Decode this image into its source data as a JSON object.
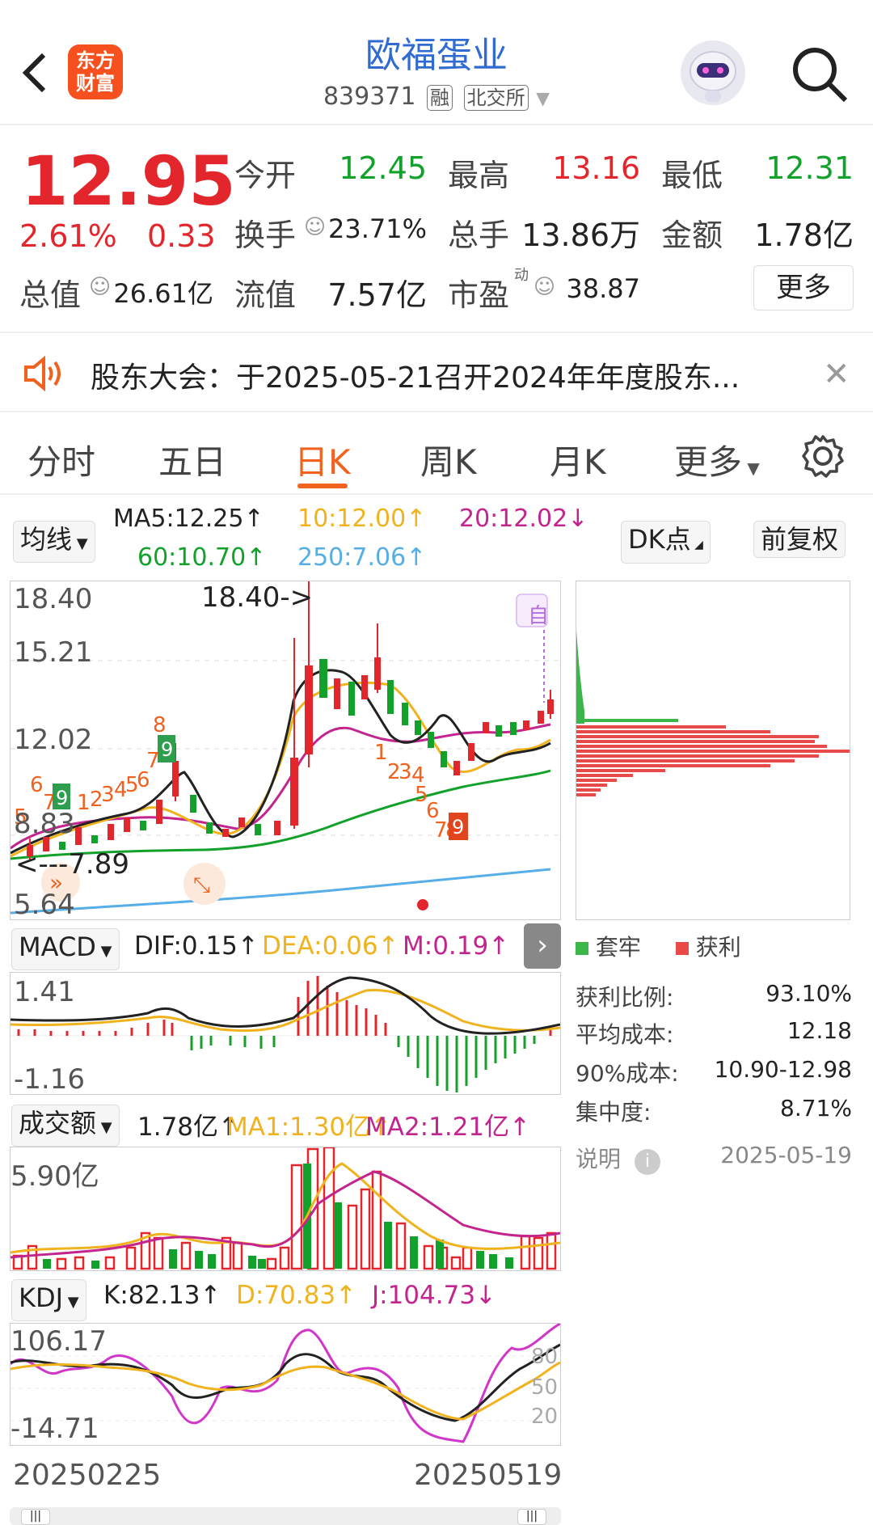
{
  "header": {
    "title": "欧福蛋业",
    "code": "839371",
    "tag1": "融",
    "tag2": "北交所",
    "logo_line1": "东方",
    "logo_line2": "财富"
  },
  "quote": {
    "price": "12.95",
    "change_pct": "2.61%",
    "change_amt": "0.33",
    "open_label": "今开",
    "open": "12.45",
    "high_label": "最高",
    "high": "13.16",
    "low_label": "最低",
    "low": "12.31",
    "turnover_label": "换手",
    "turnover": "23.71%",
    "volume_label": "总手",
    "volume": "13.86万",
    "amount_label": "金额",
    "amount": "1.78亿",
    "mktcap_label": "总值",
    "mktcap": "26.61亿",
    "float_label": "流值",
    "float": "7.57亿",
    "pe_label": "市盈",
    "pe_sup": "动",
    "pe": "38.87",
    "more": "更多"
  },
  "notice": {
    "text": "股东大会：于2025-05-21召开2024年年度股东..."
  },
  "tabs": [
    "分时",
    "五日",
    "日K",
    "周K",
    "月K",
    "更多"
  ],
  "chart_controls": {
    "ma_chip": "均线",
    "ma5": "MA5:12.25↑",
    "ma10": "10:12.00↑",
    "ma20": "20:12.02↓",
    "ma60": "60:10.70↑",
    "ma250": "250:7.06↑",
    "dk_chip": "DK点",
    "adj_chip": "前复权"
  },
  "main_chart": {
    "y_top": "18.40",
    "y_mid1": "15.21",
    "y_mid2": "12.02",
    "y_low": "8.83",
    "y_bottom": "5.64",
    "high_mark": "18.40->",
    "low_mark": "<---7.89",
    "self_tag": "自"
  },
  "macd": {
    "chip": "MACD",
    "dif": "DIF:0.15↑",
    "dea": "DEA:0.06↑",
    "m": "M:0.19↑",
    "y_top": "1.41",
    "y_bottom": "-1.16"
  },
  "amount_panel": {
    "chip": "成交额",
    "value": "1.78亿↑",
    "ma1": "MA1:1.30亿↑",
    "ma2": "MA2:1.21亿↑",
    "y_top": "5.90亿"
  },
  "kdj": {
    "chip": "KDJ",
    "k": "K:82.13↑",
    "d": "D:70.83↑",
    "j": "J:104.73↓",
    "y_top": "106.17",
    "y_bottom": "-14.71",
    "l80": "80",
    "l50": "50",
    "l20": "20"
  },
  "dates": {
    "start": "20250225",
    "end": "20250519"
  },
  "chips": {
    "legend_trap": "套牢",
    "legend_profit": "获利",
    "profit_ratio_label": "获利比例:",
    "profit_ratio": "93.10%",
    "avg_cost_label": "平均成本:",
    "avg_cost": "12.18",
    "cost90_label": "90%成本:",
    "cost90": "10.90-12.98",
    "concentration_label": "集中度:",
    "concentration": "8.71%",
    "note_label": "说明",
    "date": "2025-05-19"
  },
  "colors": {
    "up": "#e3262c",
    "down": "#12a12a",
    "accent": "#f0621e",
    "title_blue": "#2f6bd1"
  }
}
